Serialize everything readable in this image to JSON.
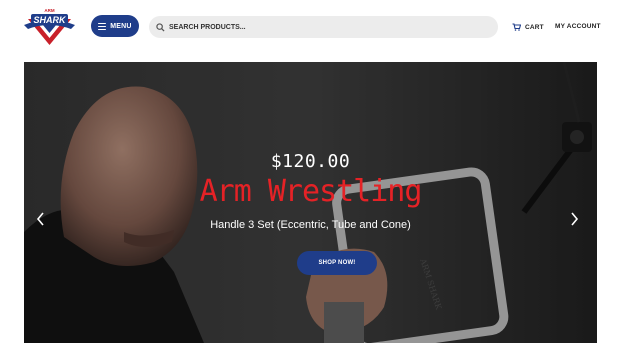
{
  "brand": {
    "logo_text": "SHARK",
    "logo_small_text": "ARM"
  },
  "header": {
    "menu_label": "MENU",
    "search_placeholder": "SEARCH PRODUCTS...",
    "cart_label": "CART",
    "account_label": "MY ACCOUNT"
  },
  "hero": {
    "price": "$120.00",
    "title": "Arm Wrestling",
    "subtitle": "Handle 3 Set (Eccentric, Tube and Cone)",
    "cta_label": "SHOP NOW!",
    "handle_print": "ARM SHARK"
  },
  "colors": {
    "brand_blue": "#1f3d8a",
    "accent_red": "#e52226"
  }
}
